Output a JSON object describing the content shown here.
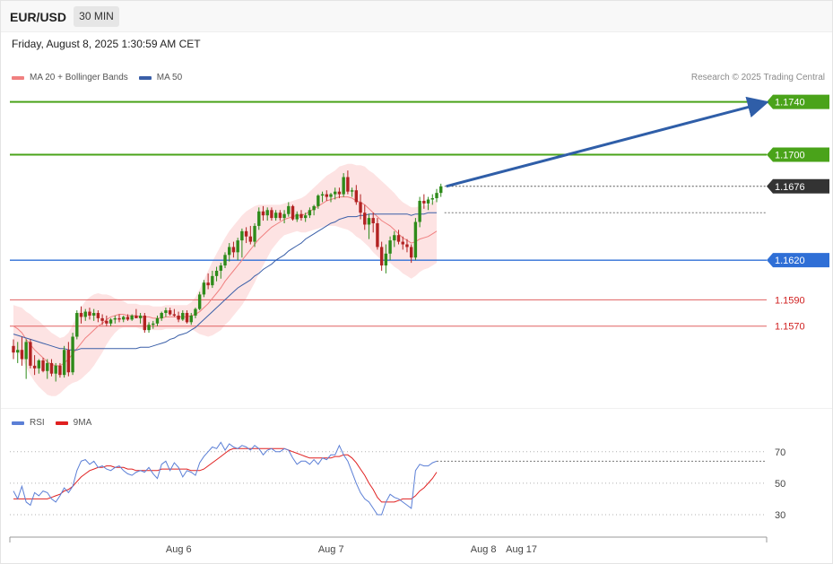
{
  "header": {
    "pair": "EUR/USD",
    "timeframe": "30 MIN",
    "datetime": "Friday, August 8, 2025 1:30:59 AM CET"
  },
  "legend_main": {
    "ma20_label": "MA 20 + Bollinger Bands",
    "ma50_label": "MA 50",
    "ma20_color": "#f08080",
    "ma50_color": "#3a5fa8"
  },
  "credit": "Research © 2025 Trading Central",
  "legend_rsi": {
    "rsi_label": "RSI",
    "ma9_label": "9MA",
    "rsi_color": "#5b7fd6",
    "ma9_color": "#e02020"
  },
  "colors": {
    "up": "#2e8b1a",
    "down": "#b22222",
    "resistance": "#4aa31a",
    "support_blue": "#2f6fd6",
    "support_red": "#e06060",
    "arrow": "#2f5ea8",
    "current": "#333333"
  },
  "chart_data": {
    "type": "candlestick",
    "price_levels": [
      {
        "value": 1.174,
        "label": "1.1740",
        "kind": "resistance"
      },
      {
        "value": 1.17,
        "label": "1.1700",
        "kind": "resistance"
      },
      {
        "value": 1.1676,
        "label": "1.1676",
        "kind": "current"
      },
      {
        "value": 1.162,
        "label": "1.1620",
        "kind": "support-primary"
      },
      {
        "value": 1.159,
        "label": "1.1590",
        "kind": "support"
      },
      {
        "value": 1.157,
        "label": "1.1570",
        "kind": "support"
      }
    ],
    "ylim": [
      1.151,
      1.1752
    ],
    "x_ticks": [
      "Aug 6",
      "Aug 7",
      "Aug 8",
      "Aug 17"
    ],
    "tick_bar_index": [
      24,
      60,
      96,
      105
    ],
    "target_value": 1.174,
    "candles": [
      [
        1.1555,
        1.156,
        1.1545,
        1.155
      ],
      [
        1.155,
        1.1558,
        1.1542,
        1.1552
      ],
      [
        1.1552,
        1.1562,
        1.154,
        1.1545
      ],
      [
        1.1545,
        1.156,
        1.153,
        1.1558
      ],
      [
        1.1558,
        1.156,
        1.1538,
        1.154
      ],
      [
        1.154,
        1.1548,
        1.1533,
        1.1538
      ],
      [
        1.1538,
        1.1545,
        1.1534,
        1.1544
      ],
      [
        1.1544,
        1.1546,
        1.1535,
        1.1536
      ],
      [
        1.1536,
        1.1545,
        1.153,
        1.1542
      ],
      [
        1.1542,
        1.1545,
        1.1532,
        1.1534
      ],
      [
        1.1534,
        1.1542,
        1.1528,
        1.154
      ],
      [
        1.154,
        1.1542,
        1.1531,
        1.1533
      ],
      [
        1.1533,
        1.1555,
        1.1531,
        1.1552
      ],
      [
        1.1552,
        1.1558,
        1.1532,
        1.1535
      ],
      [
        1.1535,
        1.1565,
        1.1533,
        1.1562
      ],
      [
        1.1562,
        1.1582,
        1.156,
        1.158
      ],
      [
        1.158,
        1.1585,
        1.1572,
        1.1577
      ],
      [
        1.1577,
        1.1583,
        1.1574,
        1.1581
      ],
      [
        1.1581,
        1.1584,
        1.1575,
        1.1578
      ],
      [
        1.1578,
        1.1583,
        1.1574,
        1.158
      ],
      [
        1.158,
        1.1582,
        1.1573,
        1.1576
      ],
      [
        1.1576,
        1.1579,
        1.1571,
        1.1574
      ],
      [
        1.1574,
        1.1578,
        1.157,
        1.1572
      ],
      [
        1.1572,
        1.1576,
        1.157,
        1.1575
      ],
      [
        1.1575,
        1.1578,
        1.1572,
        1.1576
      ],
      [
        1.1576,
        1.1579,
        1.1573,
        1.1575
      ],
      [
        1.1575,
        1.1578,
        1.1573,
        1.1577
      ],
      [
        1.1577,
        1.1579,
        1.1574,
        1.1575
      ],
      [
        1.1575,
        1.1579,
        1.1574,
        1.1578
      ],
      [
        1.1578,
        1.1583,
        1.1576,
        1.1576
      ],
      [
        1.1576,
        1.158,
        1.1572,
        1.1578
      ],
      [
        1.1578,
        1.158,
        1.1565,
        1.1567
      ],
      [
        1.1567,
        1.1573,
        1.1565,
        1.1571
      ],
      [
        1.1571,
        1.1574,
        1.1568,
        1.1572
      ],
      [
        1.1572,
        1.1578,
        1.157,
        1.1576
      ],
      [
        1.1576,
        1.1581,
        1.1574,
        1.158
      ],
      [
        1.158,
        1.1584,
        1.1577,
        1.1582
      ],
      [
        1.1582,
        1.1584,
        1.1578,
        1.1579
      ],
      [
        1.1579,
        1.1583,
        1.1577,
        1.1578
      ],
      [
        1.1578,
        1.1581,
        1.1573,
        1.1575
      ],
      [
        1.1575,
        1.1582,
        1.1574,
        1.158
      ],
      [
        1.158,
        1.1582,
        1.1572,
        1.1573
      ],
      [
        1.1573,
        1.158,
        1.1571,
        1.1578
      ],
      [
        1.1578,
        1.1584,
        1.1576,
        1.1583
      ],
      [
        1.1583,
        1.1596,
        1.1582,
        1.1594
      ],
      [
        1.1594,
        1.1605,
        1.1592,
        1.1603
      ],
      [
        1.1603,
        1.161,
        1.1598,
        1.1601
      ],
      [
        1.1601,
        1.1612,
        1.1599,
        1.1608
      ],
      [
        1.1608,
        1.1615,
        1.1604,
        1.1612
      ],
      [
        1.1612,
        1.1618,
        1.1606,
        1.1616
      ],
      [
        1.1616,
        1.1626,
        1.1614,
        1.1624
      ],
      [
        1.1624,
        1.1633,
        1.1619,
        1.163
      ],
      [
        1.163,
        1.1634,
        1.1622,
        1.1626
      ],
      [
        1.1626,
        1.1637,
        1.162,
        1.1635
      ],
      [
        1.1635,
        1.1644,
        1.1622,
        1.1642
      ],
      [
        1.1642,
        1.1645,
        1.1633,
        1.1638
      ],
      [
        1.1638,
        1.1646,
        1.1632,
        1.1634
      ],
      [
        1.1634,
        1.1648,
        1.163,
        1.1646
      ],
      [
        1.1646,
        1.166,
        1.1643,
        1.1657
      ],
      [
        1.1657,
        1.1661,
        1.165,
        1.1654
      ],
      [
        1.1654,
        1.166,
        1.165,
        1.1658
      ],
      [
        1.1658,
        1.166,
        1.165,
        1.1652
      ],
      [
        1.1652,
        1.1658,
        1.165,
        1.1656
      ],
      [
        1.1656,
        1.1658,
        1.165,
        1.1652
      ],
      [
        1.1652,
        1.1658,
        1.1648,
        1.1655
      ],
      [
        1.1655,
        1.1664,
        1.1653,
        1.1661
      ],
      [
        1.1661,
        1.1662,
        1.165,
        1.1651
      ],
      [
        1.1651,
        1.1657,
        1.1649,
        1.1655
      ],
      [
        1.1655,
        1.1658,
        1.165,
        1.1652
      ],
      [
        1.1652,
        1.1656,
        1.1649,
        1.1654
      ],
      [
        1.1654,
        1.166,
        1.1652,
        1.1658
      ],
      [
        1.1658,
        1.1662,
        1.1654,
        1.1661
      ],
      [
        1.1661,
        1.167,
        1.1659,
        1.1669
      ],
      [
        1.1669,
        1.1672,
        1.1664,
        1.167
      ],
      [
        1.167,
        1.1673,
        1.1665,
        1.1668
      ],
      [
        1.1668,
        1.1671,
        1.1664,
        1.167
      ],
      [
        1.167,
        1.1675,
        1.1666,
        1.1672
      ],
      [
        1.1672,
        1.1675,
        1.1667,
        1.167
      ],
      [
        1.167,
        1.1686,
        1.1668,
        1.1683
      ],
      [
        1.1683,
        1.1688,
        1.167,
        1.1672
      ],
      [
        1.1672,
        1.1675,
        1.1668,
        1.1673
      ],
      [
        1.1673,
        1.1677,
        1.1662,
        1.1664
      ],
      [
        1.1664,
        1.167,
        1.1651,
        1.1656
      ],
      [
        1.1656,
        1.1662,
        1.1643,
        1.1647
      ],
      [
        1.1647,
        1.1655,
        1.1636,
        1.1652
      ],
      [
        1.1652,
        1.1656,
        1.1641,
        1.1648
      ],
      [
        1.1648,
        1.1652,
        1.1628,
        1.163
      ],
      [
        1.163,
        1.1634,
        1.1612,
        1.1616
      ],
      [
        1.1616,
        1.1632,
        1.161,
        1.1625
      ],
      [
        1.1625,
        1.1638,
        1.162,
        1.1635
      ],
      [
        1.1635,
        1.1642,
        1.163,
        1.1639
      ],
      [
        1.1639,
        1.1643,
        1.1632,
        1.1634
      ],
      [
        1.1634,
        1.1638,
        1.1628,
        1.1632
      ],
      [
        1.1632,
        1.1636,
        1.1626,
        1.163
      ],
      [
        1.163,
        1.1632,
        1.1618,
        1.1622
      ],
      [
        1.1622,
        1.1652,
        1.162,
        1.1649
      ],
      [
        1.1649,
        1.1668,
        1.1645,
        1.1665
      ],
      [
        1.1665,
        1.167,
        1.1659,
        1.1663
      ],
      [
        1.1663,
        1.1668,
        1.1658,
        1.1666
      ],
      [
        1.1666,
        1.167,
        1.1662,
        1.1667
      ],
      [
        1.1667,
        1.1674,
        1.1664,
        1.1671
      ],
      [
        1.1671,
        1.1678,
        1.1668,
        1.1676
      ]
    ],
    "ma50": [
      1.1564,
      1.1563,
      1.1562,
      1.1561,
      1.156,
      1.1559,
      1.1558,
      1.1557,
      1.1556,
      1.1555,
      1.1554,
      1.1553,
      1.1553,
      1.1552,
      1.1552,
      1.1552,
      1.1553,
      1.1553,
      1.1553,
      1.1553,
      1.1553,
      1.1553,
      1.1553,
      1.1553,
      1.1553,
      1.1553,
      1.1553,
      1.1553,
      1.1553,
      1.1553,
      1.1554,
      1.1554,
      1.1554,
      1.1555,
      1.1556,
      1.1557,
      1.1558,
      1.156,
      1.1561,
      1.1563,
      1.1564,
      1.1565,
      1.1567,
      1.1569,
      1.1572,
      1.1575,
      1.1578,
      1.1581,
      1.1584,
      1.1587,
      1.159,
      1.1593,
      1.1596,
      1.1599,
      1.1601,
      1.1603,
      1.1605,
      1.1608,
      1.161,
      1.1613,
      1.1615,
      1.1617,
      1.162,
      1.1622,
      1.1624,
      1.1627,
      1.1629,
      1.1631,
      1.1633,
      1.1636,
      1.1638,
      1.164,
      1.1642,
      1.1644,
      1.1646,
      1.1648,
      1.1649,
      1.1651,
      1.1652,
      1.1653,
      1.1653,
      1.1653,
      1.1654,
      1.1654,
      1.1655,
      1.1655,
      1.1655,
      1.1655,
      1.1655,
      1.1655,
      1.1655,
      1.1655,
      1.1655,
      1.1655,
      1.1654,
      1.1655,
      1.1655,
      1.1655,
      1.1656,
      1.1656,
      1.1656
    ],
    "ma20": [
      1.157,
      1.1568,
      1.1565,
      1.156,
      1.1556,
      1.1552,
      1.1549,
      1.1546,
      1.1543,
      1.1541,
      1.154,
      1.154,
      1.1542,
      1.1545,
      1.1549,
      1.1553,
      1.1557,
      1.1561,
      1.1564,
      1.1567,
      1.157,
      1.1572,
      1.1575,
      1.1577,
      1.1578,
      1.1579,
      1.1579,
      1.1578,
      1.1578,
      1.1578,
      1.1577,
      1.1577,
      1.1577,
      1.1576,
      1.1576,
      1.1576,
      1.1577,
      1.1577,
      1.1577,
      1.1577,
      1.1577,
      1.1577,
      1.1578,
      1.1579,
      1.1581,
      1.1584,
      1.1587,
      1.1591,
      1.1595,
      1.1599,
      1.1604,
      1.1608,
      1.1612,
      1.1616,
      1.162,
      1.1624,
      1.1628,
      1.1632,
      1.1636,
      1.1639,
      1.1642,
      1.1645,
      1.1647,
      1.1649,
      1.1651,
      1.1652,
      1.1653,
      1.1654,
      1.1654,
      1.1655,
      1.1657,
      1.1659,
      1.1661,
      1.1663,
      1.1665,
      1.1666,
      1.1667,
      1.1668,
      1.1668,
      1.1668,
      1.1667,
      1.1665,
      1.1664,
      1.1662,
      1.1659,
      1.1656,
      1.1653,
      1.165,
      1.1648,
      1.1646,
      1.1643,
      1.164,
      1.1637,
      1.1635,
      1.1633,
      1.1634,
      1.1636,
      1.1637,
      1.1638,
      1.164,
      1.1642
    ],
    "bb_width": [
      0.0016,
      0.0017,
      0.0019,
      0.0021,
      0.0023,
      0.0024,
      0.0025,
      0.0025,
      0.0025,
      0.0024,
      0.0023,
      0.0021,
      0.002,
      0.002,
      0.0022,
      0.0025,
      0.0027,
      0.0028,
      0.0028,
      0.0027,
      0.0025,
      0.0022,
      0.0019,
      0.0016,
      0.0013,
      0.0011,
      0.001,
      0.0009,
      0.0009,
      0.0009,
      0.0009,
      0.0009,
      0.0009,
      0.0009,
      0.0009,
      0.0009,
      0.0009,
      0.0009,
      0.0009,
      0.0009,
      0.0009,
      0.0009,
      0.001,
      0.0013,
      0.0017,
      0.0021,
      0.0025,
      0.0028,
      0.003,
      0.0032,
      0.0033,
      0.0034,
      0.0034,
      0.0034,
      0.0034,
      0.0033,
      0.0031,
      0.0029,
      0.0026,
      0.0023,
      0.002,
      0.0017,
      0.0015,
      0.0013,
      0.0012,
      0.0012,
      0.0012,
      0.0012,
      0.0013,
      0.0014,
      0.0015,
      0.0016,
      0.0017,
      0.0018,
      0.0019,
      0.002,
      0.0021,
      0.0023,
      0.0024,
      0.0025,
      0.0026,
      0.0027,
      0.0028,
      0.0029,
      0.0029,
      0.003,
      0.003,
      0.003,
      0.0029,
      0.0028,
      0.0028,
      0.0027,
      0.0027,
      0.0027,
      0.0027,
      0.0026,
      0.0025,
      0.0024,
      0.0024,
      0.0024,
      0.0024
    ],
    "rsi": {
      "ticks": [
        70,
        50,
        30
      ],
      "ylim": [
        22,
        79
      ],
      "rsi_values": [
        45,
        40,
        48,
        38,
        36,
        44,
        42,
        45,
        44,
        40,
        38,
        42,
        47,
        44,
        48,
        58,
        64,
        65,
        62,
        64,
        60,
        61,
        59,
        58,
        60,
        61,
        58,
        56,
        55,
        57,
        58,
        57,
        60,
        56,
        53,
        62,
        64,
        58,
        63,
        60,
        54,
        58,
        57,
        55,
        63,
        67,
        70,
        73,
        72,
        76,
        71,
        75,
        73,
        72,
        74,
        73,
        71,
        74,
        72,
        68,
        71,
        72,
        70,
        70,
        72,
        71,
        66,
        62,
        64,
        64,
        62,
        65,
        62,
        66,
        65,
        68,
        68,
        74,
        68,
        64,
        57,
        50,
        44,
        40,
        38,
        34,
        30,
        30,
        38,
        43,
        41,
        40,
        38,
        36,
        34,
        58,
        62,
        61,
        61,
        63,
        64
      ],
      "ma9_values": [
        40,
        40,
        40,
        40,
        40,
        40,
        40,
        40,
        40,
        41,
        42,
        43,
        45,
        46,
        48,
        51,
        54,
        56,
        58,
        59,
        60,
        60,
        61,
        61,
        60,
        60,
        60,
        59,
        59,
        58,
        58,
        58,
        58,
        58,
        58,
        59,
        59,
        59,
        59,
        59,
        59,
        59,
        58,
        58,
        58,
        59,
        61,
        63,
        65,
        67,
        69,
        71,
        72,
        72,
        72,
        72,
        72,
        72,
        72,
        72,
        72,
        72,
        72,
        72,
        72,
        71,
        70,
        69,
        68,
        67,
        66,
        66,
        66,
        66,
        66,
        66,
        67,
        67,
        68,
        68,
        66,
        63,
        59,
        55,
        50,
        46,
        41,
        38,
        38,
        38,
        38,
        39,
        40,
        40,
        40,
        42,
        45,
        47,
        50,
        53,
        57
      ]
    }
  }
}
